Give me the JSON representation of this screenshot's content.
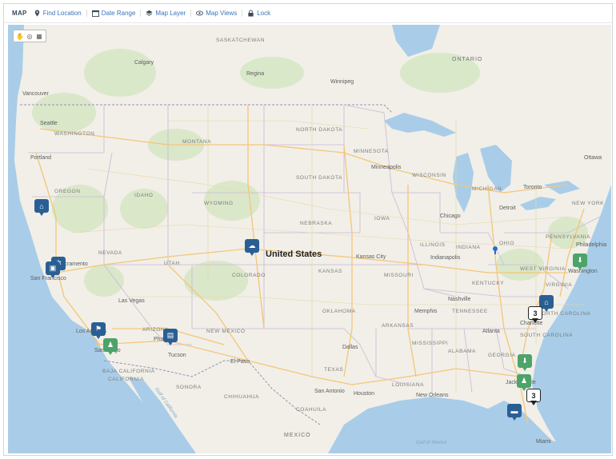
{
  "toolbar": {
    "title": "MAP",
    "items": [
      {
        "label": "Find Location",
        "icon": "location-pin-icon"
      },
      {
        "label": "Date Range",
        "icon": "calendar-icon"
      },
      {
        "label": "Map Layer",
        "icon": "layers-icon"
      },
      {
        "label": "Map Views",
        "icon": "eye-icon"
      },
      {
        "label": "Lock",
        "icon": "lock-icon"
      }
    ]
  },
  "map_controls": [
    {
      "icon": "hand-pan-icon",
      "glyph": "✋"
    },
    {
      "icon": "circle-select-icon",
      "glyph": "◎"
    },
    {
      "icon": "square-select-icon",
      "glyph": "▦"
    }
  ],
  "labels": {
    "countries": [
      "ONTARIO",
      "MEXICO"
    ],
    "main": "United States",
    "states": [
      "WASHINGTON",
      "OREGON",
      "IDAHO",
      "MONTANA",
      "WYOMING",
      "NEVADA",
      "UTAH",
      "COLORADO",
      "NORTH DAKOTA",
      "SOUTH DAKOTA",
      "NEBRASKA",
      "KANSAS",
      "MINNESOTA",
      "IOWA",
      "WISCONSIN",
      "MICHIGAN",
      "ILLINOIS",
      "INDIANA",
      "OHIO",
      "MISSOURI",
      "KENTUCKY",
      "TENNESSEE",
      "ARKANSAS",
      "OKLAHOMA",
      "TEXAS",
      "LOUISIANA",
      "MISSISSIPPI",
      "ALABAMA",
      "GEORGIA",
      "SOUTH CAROLINA",
      "NORTH CAROLINA",
      "VIRGINIA",
      "WEST VIRGINIA",
      "PENNSYLVANIA",
      "NEW YORK",
      "NEW MEXICO",
      "ARIZONA",
      "CALIFORNIA",
      "SONORA",
      "CHIHUAHUA",
      "COAHUILA",
      "BAJA CALIFORNIA",
      "SASKATCHEWAN"
    ],
    "cities": [
      "Calgary",
      "Regina",
      "Winnipeg",
      "Vancouver",
      "Seattle",
      "Portland",
      "Minneapolis",
      "Chicago",
      "Detroit",
      "Toronto",
      "Ottawa",
      "Kansas City",
      "Indianapolis",
      "Philadelphia",
      "Washington",
      "Nashville",
      "Atlanta",
      "Charlotte",
      "Dallas",
      "Houston",
      "San Antonio",
      "El Paso",
      "Tucson",
      "Phoenix",
      "Las Vegas",
      "Los Angeles",
      "San Diego",
      "San Francisco",
      "Sacramento",
      "Miami",
      "Jacksonville",
      "Memphis",
      "New Orleans"
    ],
    "seas": [
      "Gulf of Mexico",
      "Gulf of California"
    ]
  },
  "markers": [
    {
      "type": "blue",
      "icon": "house-icon",
      "glyph": "⌂"
    },
    {
      "type": "blue",
      "icon": "medical-icon",
      "glyph": "✱"
    },
    {
      "type": "blue",
      "icon": "user-icon",
      "glyph": "⚑"
    },
    {
      "type": "blue",
      "icon": "computer-icon",
      "glyph": "▣"
    },
    {
      "type": "green",
      "icon": "user-green-icon",
      "glyph": "♟"
    },
    {
      "type": "blue",
      "icon": "tool-icon",
      "glyph": "▤"
    },
    {
      "type": "blue",
      "icon": "cloud-icon",
      "glyph": "☁"
    },
    {
      "type": "green",
      "icon": "download-icon",
      "glyph": "⬇"
    },
    {
      "type": "blue",
      "icon": "house-icon",
      "glyph": "⌂"
    },
    {
      "type": "count",
      "icon": "cluster-count-icon",
      "glyph": "3"
    },
    {
      "type": "green",
      "icon": "download-icon",
      "glyph": "⬇"
    },
    {
      "type": "green",
      "icon": "user-green-icon",
      "glyph": "♟"
    },
    {
      "type": "count",
      "icon": "cluster-count-icon",
      "glyph": "3"
    },
    {
      "type": "blue",
      "icon": "car-icon",
      "glyph": "▬"
    }
  ],
  "colors": {
    "land": "#f1efe8",
    "water": "#a9cde8",
    "park": "#d6e6c4",
    "highway": "#f4c677",
    "marker_blue": "#2a5f94",
    "marker_green": "#4da36a",
    "accent": "#3a74b8"
  }
}
